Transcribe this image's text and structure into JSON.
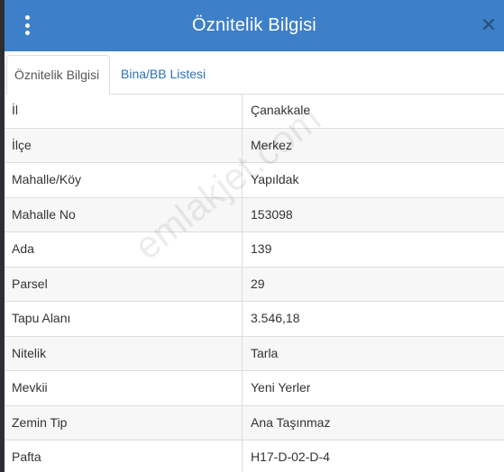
{
  "header": {
    "title": "Öznitelik Bilgisi",
    "menu_icon": "vertical-dots-icon",
    "close_icon": "close-icon",
    "close_glyph": "✕"
  },
  "tabs": [
    {
      "label": "Öznitelik Bilgisi",
      "active": true
    },
    {
      "label": "Bina/BB Listesi",
      "active": false
    }
  ],
  "rows": [
    {
      "key": "İl",
      "value": "Çanakkale"
    },
    {
      "key": "İlçe",
      "value": "Merkez"
    },
    {
      "key": "Mahalle/Köy",
      "value": "Yapıldak"
    },
    {
      "key": "Mahalle No",
      "value": "153098"
    },
    {
      "key": "Ada",
      "value": "139"
    },
    {
      "key": "Parsel",
      "value": "29"
    },
    {
      "key": "Tapu Alanı",
      "value": "3.546,18"
    },
    {
      "key": "Nitelik",
      "value": "Tarla"
    },
    {
      "key": "Mevkii",
      "value": "Yeni Yerler"
    },
    {
      "key": "Zemin Tip",
      "value": "Ana Taşınmaz"
    },
    {
      "key": "Pafta",
      "value": "H17-D-02-D-4"
    }
  ],
  "watermark": "emlakjet.com",
  "colors": {
    "header_bg": "#3d7fc8",
    "tab_link": "#2f72b8",
    "row_alt": "#f7f7f7",
    "border": "#dddddd"
  }
}
